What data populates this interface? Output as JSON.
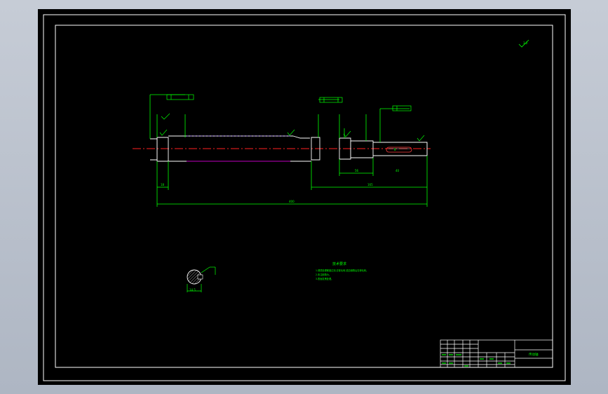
{
  "drawing": {
    "title_block_name": "传动轴",
    "tech_requirements": {
      "heading": "技术要求",
      "lines": [
        "1.调质处理硬度达到,去除毛刺,锐边倒角后去掉毛刺。",
        "2.未注倒角为。",
        "3.表面发黑处理。"
      ]
    },
    "roughness_note": "3.2",
    "dims": {
      "overall_length": "400",
      "right_section": "165",
      "left_shoulder": "18",
      "section_width": "56",
      "keyway_len": "40",
      "keyway_width": "8",
      "section_dia": "14.5"
    }
  },
  "colors": {
    "background": "#000000",
    "frame": "#ffffff",
    "geometry": "#ffffff",
    "dimension": "#00ff00",
    "centerline": "#ff2020",
    "hidden": "#c000c0"
  }
}
